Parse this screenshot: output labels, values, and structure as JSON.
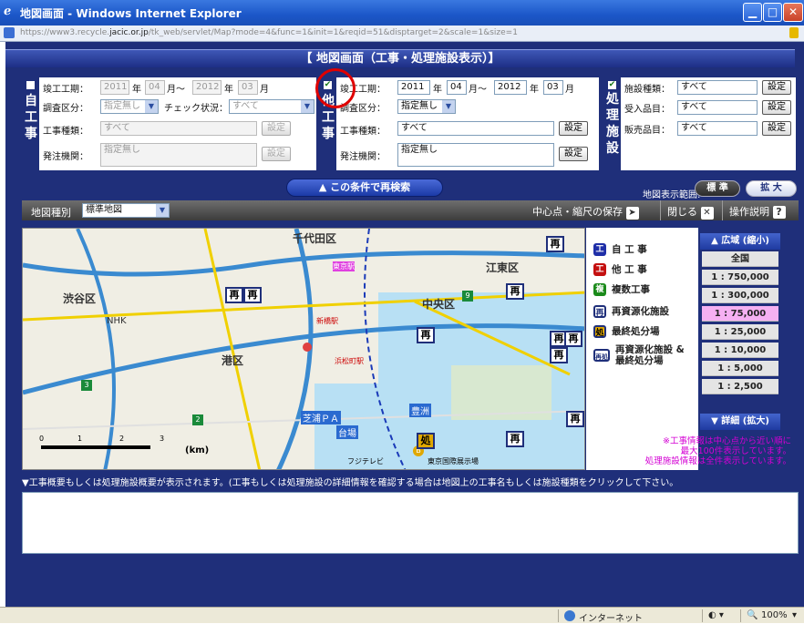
{
  "window": {
    "title": "地図画面 - Windows Internet Explorer",
    "url_prefix": "https://www3.recycle.",
    "url_domain": "jacic.or.jp",
    "url_rest": "/tk_web/servlet/Map?mode=4&func=1&init=1&reqid=51&disptarget=2&scale=1&size=1"
  },
  "header": {
    "title": "【 地図画面（工事・処理施設表示）】"
  },
  "self_panel": {
    "side_label": [
      "自",
      "工",
      "事"
    ],
    "completion_label": "竣工工期：",
    "year_from": "2011",
    "month_from": "04",
    "year_to": "2012",
    "month_to": "03",
    "year_unit": "年",
    "month_unit": "月～",
    "month_unit2": "月",
    "survey_label": "調査区分：",
    "survey_value": "指定無し",
    "check_label": "チェック状況：",
    "check_value": "すべて",
    "type_label": "工事種類：",
    "type_value": "すべて",
    "type_btn": "設定",
    "org_label": "発注機関：",
    "org_value": "指定無し",
    "org_btn": "設定"
  },
  "other_panel": {
    "check_mark": "✔",
    "side_label": [
      "他",
      "工",
      "事"
    ],
    "completion_label": "竣工工期：",
    "year_from": "2011",
    "month_from": "04",
    "year_to": "2012",
    "month_to": "03",
    "survey_label": "調査区分：",
    "survey_value": "指定無し",
    "type_label": "工事種類：",
    "type_value": "すべて",
    "type_btn": "設定",
    "org_label": "発注機関：",
    "org_value": "指定無し",
    "org_btn": "設定"
  },
  "facility_panel": {
    "check_mark": "✔",
    "side_label": [
      "処",
      "理",
      "施",
      "設"
    ],
    "facility_label": "施設種類：",
    "facility_value": "すべて",
    "facility_btn": "設定",
    "accept_label": "受入品目：",
    "accept_value": "すべて",
    "accept_btn": "設定",
    "sale_label": "販売品目：",
    "sale_value": "すべて",
    "sale_btn": "設定"
  },
  "research_button": "▲ この条件で再検索",
  "map_range": {
    "label": "地図表示範囲:",
    "standard": "標 準",
    "expand": "拡 大"
  },
  "map_toolbar": {
    "type_label": "地図種別",
    "type_value": "標準地図",
    "save": "中心点・縮尺の保存",
    "close": "閉じる",
    "help": "操作説明"
  },
  "map": {
    "labels": [
      "千代田区",
      "江東区",
      "渋谷区",
      "中央区",
      "港区",
      "NHK",
      "芝浦ＰＡ",
      "台場",
      "豊洲",
      "新橋駅",
      "東京駅",
      "浜松町駅",
      "(km)",
      "0",
      "1",
      "2",
      "3",
      "フジテレビ",
      "東京国際展示場"
    ],
    "road_numbers": [
      "9",
      "3",
      "2",
      "B"
    ]
  },
  "legend": [
    {
      "icon": "工",
      "color": "#1f2fa8",
      "label": "自 工 事"
    },
    {
      "icon": "工",
      "color": "#c41010",
      "label": "他 工 事"
    },
    {
      "icon": "複",
      "color": "#1a8a1a",
      "label": "複数工事"
    },
    {
      "icon": "再",
      "color": "#1f2f7a",
      "label": "再資源化施設"
    },
    {
      "icon": "処",
      "color": "#e0a800",
      "label": "最終処分場"
    },
    {
      "icon": "再処",
      "color": "#1f2f7a",
      "label": "再資源化施設 &最終処分場"
    }
  ],
  "scale": {
    "top": "▲ 広域 (縮小)",
    "rows": [
      "全国",
      "1 : 750,000",
      "1 : 300,000",
      "1 :  75,000",
      "1 :  25,000",
      "1 :  10,000",
      "1 :   5,000",
      "1 :   2,500"
    ],
    "active_index": 3,
    "bottom": "▼ 詳細 (拡大)"
  },
  "note": [
    "※工事情報は中心点から近い順に",
    "最大100件表示しています。",
    "処理施設情報は全件表示しています。"
  ],
  "description": "▼工事概要もしくは処理施設概要が表示されます。(工事もしくは処理施設の詳細情報を確認する場合は地図上の工事名もしくは施設種類をクリックして下さい。",
  "status": {
    "zone": "インターネット",
    "zoom": "100%"
  },
  "colors": {
    "navy": "#1f2f7a",
    "highlight": "#f5b0f2",
    "note": "#d400d4"
  }
}
